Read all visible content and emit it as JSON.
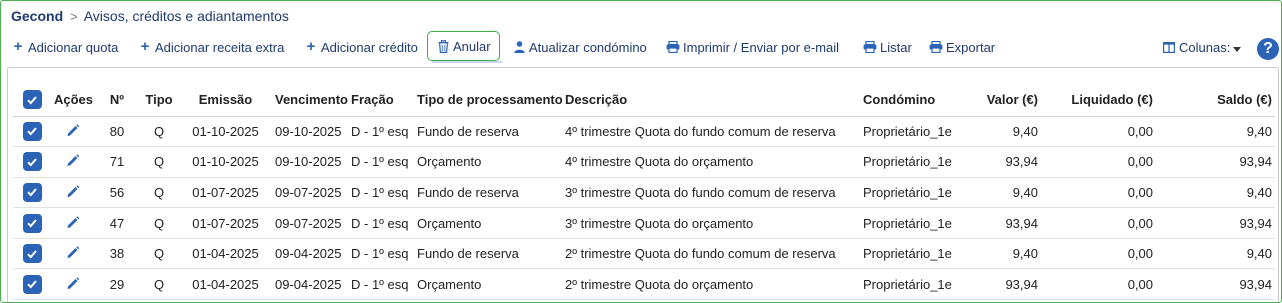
{
  "breadcrumb": {
    "root": "Gecond",
    "separator": ">",
    "page": "Avisos, créditos e adiantamentos"
  },
  "toolbar": {
    "add_quota": "Adicionar quota",
    "add_extra_revenue": "Adicionar receita extra",
    "add_credit": "Adicionar crédito",
    "cancel": "Anular",
    "update_condo": "Atualizar condómino",
    "print_email": "Imprimir / Enviar por e-mail",
    "list": "Listar",
    "export": "Exportar",
    "columns": "Colunas:",
    "help": "?"
  },
  "colors": {
    "accent": "#2b63b6",
    "brand_text": "#1f3a6e",
    "highlight_border": "#3fae49"
  },
  "table": {
    "headers": {
      "actions": "Ações",
      "number": "Nº",
      "type": "Tipo",
      "issue": "Emissão",
      "due": "Vencimento",
      "fraction": "Fração",
      "processing_type": "Tipo de processamento",
      "description": "Descrição",
      "condo": "Condómino",
      "value": "Valor (€)",
      "paid": "Liquidado (€)",
      "balance": "Saldo (€)"
    },
    "rows": [
      {
        "checked": true,
        "number": "80",
        "type": "Q",
        "issue": "01-10-2025",
        "due": "09-10-2025",
        "fraction": "D - 1º esq",
        "processing_type": "Fundo de reserva",
        "description": "4º trimestre Quota do fundo comum de reserva",
        "condo": "Proprietário_1e",
        "value": "9,40",
        "paid": "0,00",
        "balance": "9,40"
      },
      {
        "checked": true,
        "number": "71",
        "type": "Q",
        "issue": "01-10-2025",
        "due": "09-10-2025",
        "fraction": "D - 1º esq",
        "processing_type": "Orçamento",
        "description": "4º trimestre Quota do orçamento",
        "condo": "Proprietário_1e",
        "value": "93,94",
        "paid": "0,00",
        "balance": "93,94"
      },
      {
        "checked": true,
        "number": "56",
        "type": "Q",
        "issue": "01-07-2025",
        "due": "09-07-2025",
        "fraction": "D - 1º esq",
        "processing_type": "Fundo de reserva",
        "description": "3º trimestre Quota do fundo comum de reserva",
        "condo": "Proprietário_1e",
        "value": "9,40",
        "paid": "0,00",
        "balance": "9,40"
      },
      {
        "checked": true,
        "number": "47",
        "type": "Q",
        "issue": "01-07-2025",
        "due": "09-07-2025",
        "fraction": "D - 1º esq",
        "processing_type": "Orçamento",
        "description": "3º trimestre Quota do orçamento",
        "condo": "Proprietário_1e",
        "value": "93,94",
        "paid": "0,00",
        "balance": "93,94"
      },
      {
        "checked": true,
        "number": "38",
        "type": "Q",
        "issue": "01-04-2025",
        "due": "09-04-2025",
        "fraction": "D - 1º esq",
        "processing_type": "Fundo de reserva",
        "description": "2º trimestre Quota do fundo comum de reserva",
        "condo": "Proprietário_1e",
        "value": "9,40",
        "paid": "0,00",
        "balance": "9,40"
      },
      {
        "checked": true,
        "number": "29",
        "type": "Q",
        "issue": "01-04-2025",
        "due": "09-04-2025",
        "fraction": "D - 1º esq",
        "processing_type": "Orçamento",
        "description": "2º trimestre Quota do orçamento",
        "condo": "Proprietário_1e",
        "value": "93,94",
        "paid": "0,00",
        "balance": "93,94"
      }
    ]
  }
}
